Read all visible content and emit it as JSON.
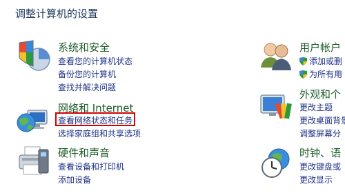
{
  "page_title": "调整计算机的设置",
  "categories": [
    {
      "title": "系统和安全",
      "icon": "security-shield-icon",
      "links": [
        "查看您的计算机状态",
        "备份您的计算机",
        "查找并解决问题"
      ]
    },
    {
      "title": "网络和 Internet",
      "icon": "network-globe-icon",
      "links": [
        "查看网络状态和任务",
        "选择家庭组和共享选项"
      ]
    },
    {
      "title": "硬件和声音",
      "icon": "printer-icon",
      "links": [
        "查看设备和打印机",
        "添加设备"
      ]
    },
    {
      "title": "用户帐户",
      "icon": "user-accounts-icon",
      "links": [
        "添加或删",
        "为所有用"
      ]
    },
    {
      "title": "外观和个",
      "icon": "appearance-icon",
      "links": [
        "更改主题",
        "更改桌面背景",
        "调整屏幕分"
      ]
    },
    {
      "title": "时钟、语",
      "icon": "clock-globe-icon",
      "links": [
        "更改键盘或",
        "更改显示"
      ]
    }
  ],
  "colors": {
    "category_title": "#1e5b2a",
    "link": "#1e3287",
    "highlight": "#d40000"
  }
}
